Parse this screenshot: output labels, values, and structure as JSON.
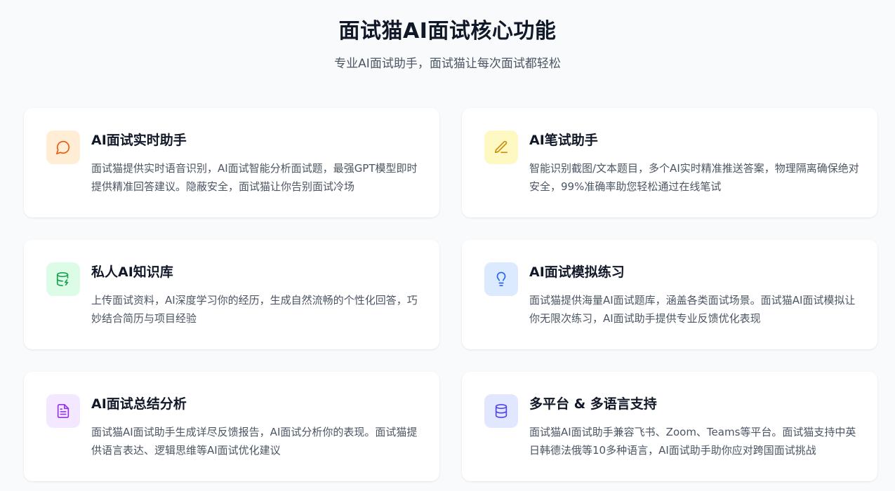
{
  "header": {
    "title": "面试猫AI面试核心功能",
    "subtitle": "专业AI面试助手，面试猫让每次面试都轻松"
  },
  "features": [
    {
      "title": "AI面试实时助手",
      "desc": "面试猫提供实时语音识别，AI面试智能分析面试题，最强GPT模型即时提供精准回答建议。隐蔽安全，面试猫让你告别面试冷场",
      "icon": "chat-bubble-icon",
      "icon_bg": "#ffedd5",
      "icon_color": "#ea580c"
    },
    {
      "title": "AI笔试助手",
      "desc": "智能识别截图/文本题目，多个AI实时精准推送答案，物理隔离确保绝对安全，99%准确率助您轻松通过在线笔试",
      "icon": "pencil-icon",
      "icon_bg": "#fef9c3",
      "icon_color": "#ca8a04"
    },
    {
      "title": "私人AI知识库",
      "desc": "上传面试资料，AI深度学习你的经历，生成自然流畅的个性化回答，巧妙结合简历与项目经验",
      "icon": "database-bolt-icon",
      "icon_bg": "#dcfce7",
      "icon_color": "#16a34a"
    },
    {
      "title": "AI面试模拟练习",
      "desc": "面试猫提供海量AI面试题库，涵盖各类面试场景。面试猫AI面试模拟让你无限次练习，AI面试助手提供专业反馈优化表现",
      "icon": "lightbulb-icon",
      "icon_bg": "#dbeafe",
      "icon_color": "#2563eb"
    },
    {
      "title": "AI面试总结分析",
      "desc": "面试猫AI面试助手生成详尽反馈报告，AI面试分析你的表现。面试猫提供语言表达、逻辑思维等AI面试优化建议",
      "icon": "document-icon",
      "icon_bg": "#f3e8ff",
      "icon_color": "#9333ea"
    },
    {
      "title": "多平台 & 多语言支持",
      "desc": "面试猫AI面试助手兼容飞书、Zoom、Teams等平台。面试猫支持中英日韩德法俄等10多种语言，AI面试助手助你应对跨国面试挑战",
      "icon": "database-icon",
      "icon_bg": "#e0e7ff",
      "icon_color": "#4f46e5"
    }
  ]
}
